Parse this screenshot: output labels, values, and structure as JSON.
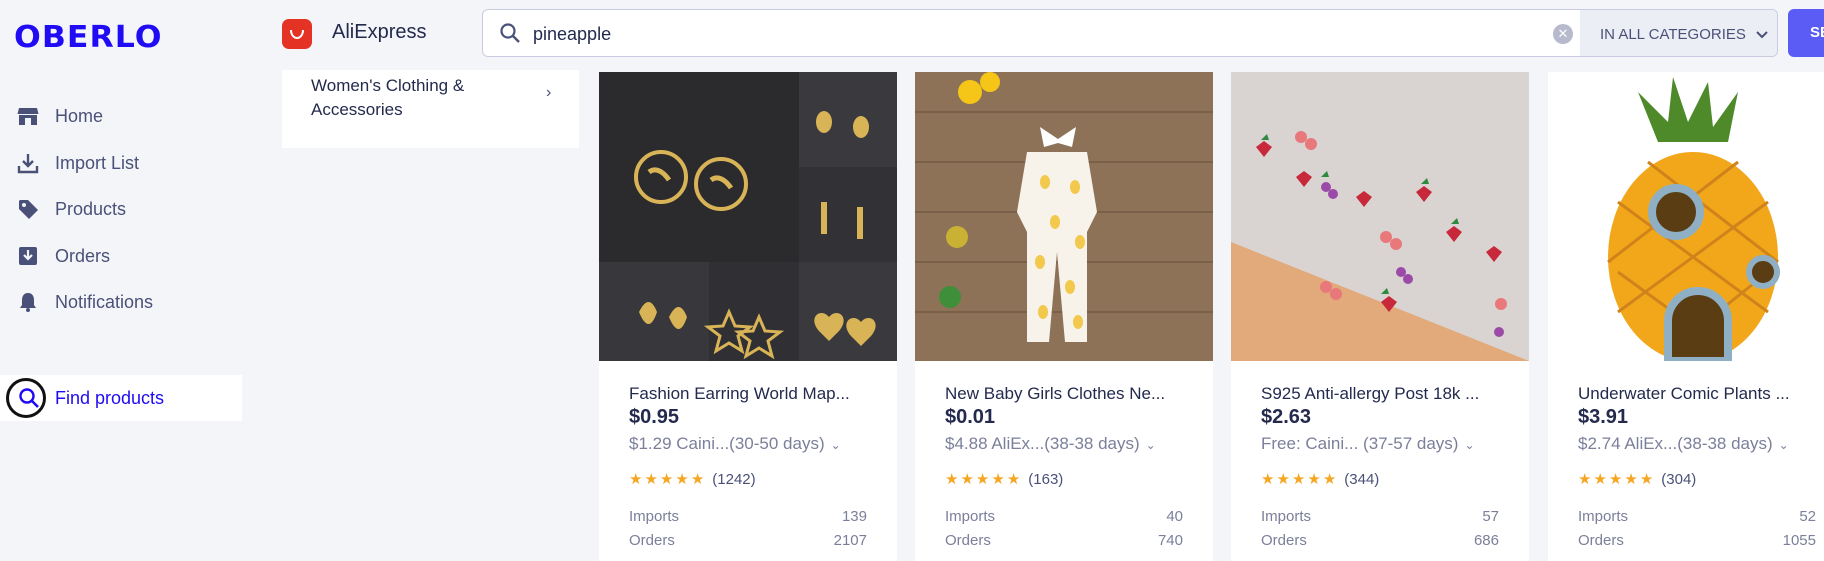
{
  "sidebar": {
    "logo": "OBERLO",
    "items": [
      {
        "label": "Home",
        "icon": "store-icon"
      },
      {
        "label": "Import List",
        "icon": "download-icon"
      },
      {
        "label": "Products",
        "icon": "tag-icon"
      },
      {
        "label": "Orders",
        "icon": "inbox-download-icon"
      },
      {
        "label": "Notifications",
        "icon": "bell-icon"
      }
    ],
    "active_item": {
      "label": "Find products",
      "icon": "search-icon"
    }
  },
  "topbar": {
    "marketplace": "AliExpress",
    "search_value": "pineapple",
    "category_select": "IN ALL CATEGORIES",
    "search_button": "SE"
  },
  "category_panel": {
    "label": "Women's Clothing & Accessories",
    "chevron": "›"
  },
  "products": [
    {
      "title": "Fashion Earring World Map...",
      "price": "$0.95",
      "shipping": "$1.29 Caini...(30-50 days)",
      "reviews": "(1242)",
      "imports_label": "Imports",
      "imports": "139",
      "orders_label": "Orders",
      "orders": "2107"
    },
    {
      "title": "New Baby Girls Clothes Ne...",
      "price": "$0.01",
      "shipping": "$4.88 AliEx...(38-38 days)",
      "reviews": "(163)",
      "imports_label": "Imports",
      "imports": "40",
      "orders_label": "Orders",
      "orders": "740"
    },
    {
      "title": "S925 Anti-allergy Post 18k ...",
      "price": "$2.63",
      "shipping": "Free: Caini... (37-57 days)",
      "reviews": "(344)",
      "imports_label": "Imports",
      "imports": "57",
      "orders_label": "Orders",
      "orders": "686"
    },
    {
      "title": "Underwater Comic Plants ...",
      "price": "$3.91",
      "shipping": "$2.74 AliEx...(38-38 days)",
      "reviews": "(304)",
      "imports_label": "Imports",
      "imports": "52",
      "orders_label": "Orders",
      "orders": "1055"
    }
  ],
  "colors": {
    "brand": "#1f0bf4",
    "accent_button": "#5b5bf5",
    "star": "#f5a623",
    "aliexpress": "#e43225"
  }
}
